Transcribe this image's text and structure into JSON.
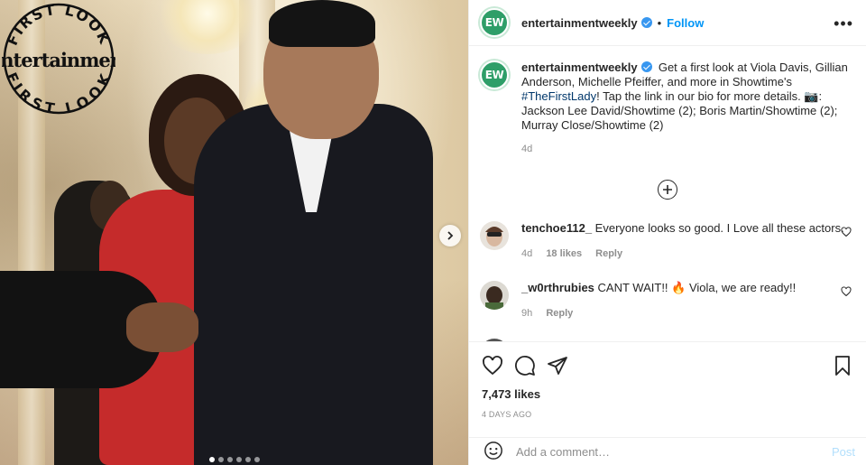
{
  "photo": {
    "watermark": {
      "arc_top": "FIRST LOOK",
      "brand": "Entertainment",
      "arc_bottom": "FIRST LOOK"
    },
    "carousel_next_icon": "chevron-right-icon",
    "dots": {
      "total": 6,
      "active_index": 0
    }
  },
  "header": {
    "avatar_text": "EW",
    "username": "entertainmentweekly",
    "separator": "•",
    "follow_label": "Follow",
    "more_icon": "more-horizontal-icon",
    "more_label": "•••"
  },
  "caption": {
    "avatar_text": "EW",
    "username": "entertainmentweekly",
    "text_before_hashtag": "Get a first look at Viola Davis, Gillian Anderson, Michelle Pfeiffer, and more in Showtime's ",
    "hashtag": "#TheFirstLady",
    "text_after_hashtag": "! Tap the link in our bio for more details. 📷: Jackson Lee David/Showtime (2); Boris Martin/Showtime (2); Murray Close/Showtime (2)",
    "time": "4d"
  },
  "load_more_icon": "plus-circle-icon",
  "comments": [
    {
      "username": "tenchoe112_",
      "text": "Everyone looks so good. I Love all these actors.",
      "time": "4d",
      "likes": "18 likes",
      "reply": "Reply"
    },
    {
      "username": "_w0rthrubies",
      "text": "CANT WAIT!! 🔥 Viola, we are ready!!",
      "time": "9h",
      "reply": "Reply"
    }
  ],
  "actions": {
    "likes": "7,473 likes",
    "date": "4 DAYS AGO"
  },
  "add_comment": {
    "placeholder": "Add a comment…",
    "post_label": "Post"
  },
  "colors": {
    "ew_green": "#2e9e68",
    "link_blue": "#0095f6",
    "hashtag_blue": "#00376b",
    "muted": "#8e8e8e",
    "post_disabled": "#b2dffc"
  }
}
